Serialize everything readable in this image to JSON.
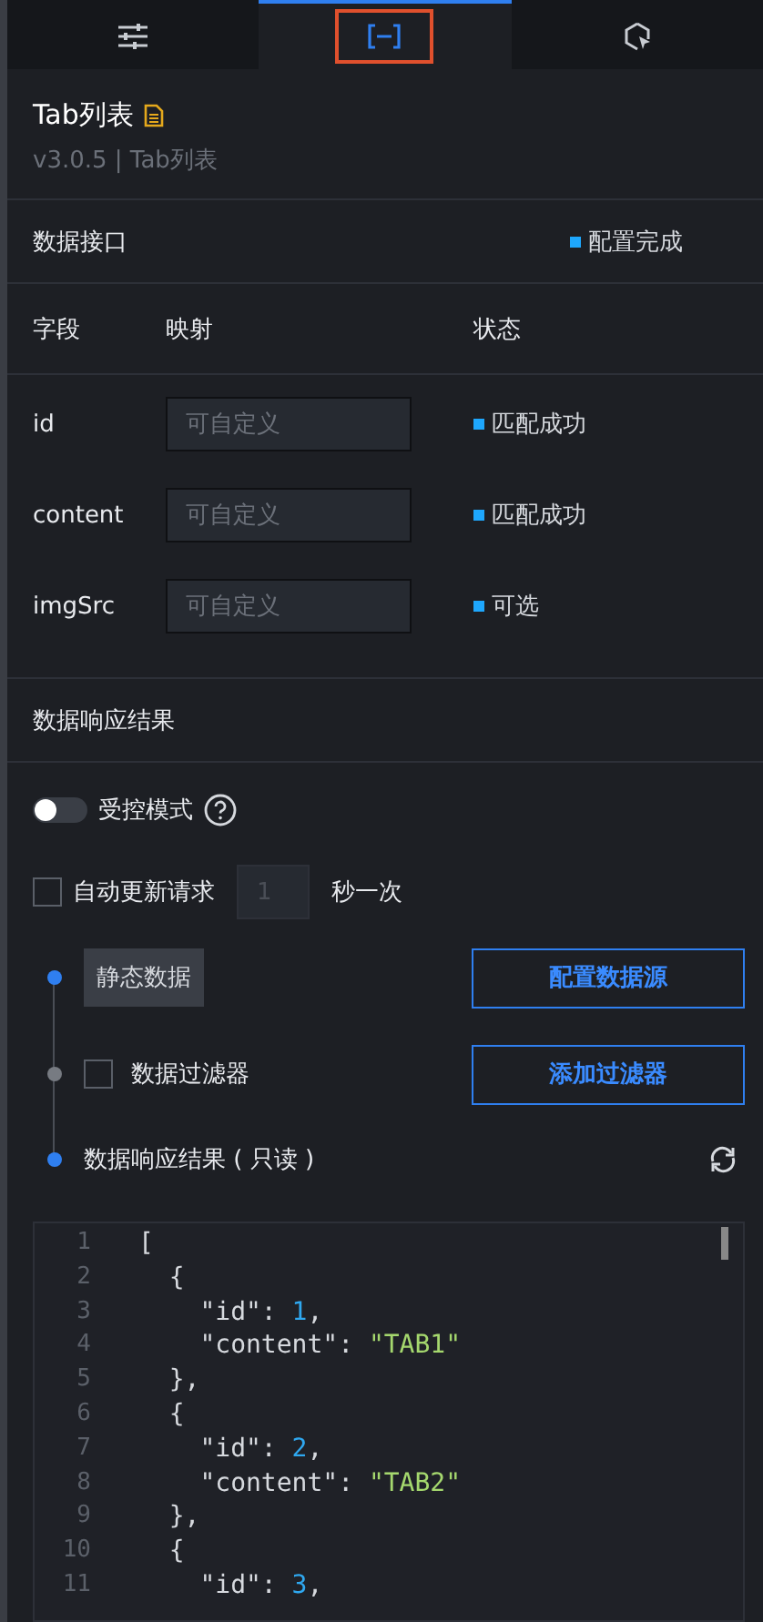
{
  "tabs": [
    {
      "kind": "sliders",
      "selected": false
    },
    {
      "kind": "bracket",
      "selected": true
    },
    {
      "kind": "cursor",
      "selected": false
    }
  ],
  "title": "Tab列表",
  "subtitle": "v3.0.5 | Tab列表",
  "interface": {
    "label": "数据接口",
    "status": "配置完成"
  },
  "fields": {
    "columns": [
      "字段",
      "映射",
      "状态"
    ],
    "rows": [
      {
        "name": "id",
        "placeholder": "可自定义",
        "status": "匹配成功"
      },
      {
        "name": "content",
        "placeholder": "可自定义",
        "status": "匹配成功"
      },
      {
        "name": "imgSrc",
        "placeholder": "可自定义",
        "status": "可选"
      }
    ]
  },
  "result_label": "数据响应结果",
  "controlled": {
    "label": "受控模式",
    "on": false
  },
  "auto_update": {
    "label": "自动更新请求",
    "checked": false,
    "value": "1",
    "unit": "秒一次"
  },
  "steps": [
    {
      "kind": "source",
      "active": true,
      "tag": "静态数据",
      "button": "配置数据源"
    },
    {
      "kind": "filter",
      "active": false,
      "label": "数据过滤器",
      "checked": false,
      "button": "添加过滤器"
    },
    {
      "kind": "result",
      "active": true,
      "label": "数据响应结果 ( 只读 )"
    }
  ],
  "editor": {
    "lines": [
      {
        "number": "1",
        "tokens": [
          {
            "kind": "punct",
            "text": "["
          }
        ]
      },
      {
        "number": "2",
        "tokens": [
          {
            "kind": "punct",
            "text": "  {"
          }
        ]
      },
      {
        "number": "3",
        "tokens": [
          {
            "kind": "key",
            "text": "    \"id\": "
          },
          {
            "kind": "number",
            "text": "1"
          },
          {
            "kind": "punct",
            "text": ","
          }
        ]
      },
      {
        "number": "4",
        "tokens": [
          {
            "kind": "key",
            "text": "    \"content\": "
          },
          {
            "kind": "string",
            "text": "\"TAB1\""
          }
        ]
      },
      {
        "number": "5",
        "tokens": [
          {
            "kind": "punct",
            "text": "  },"
          }
        ]
      },
      {
        "number": "6",
        "tokens": [
          {
            "kind": "punct",
            "text": "  {"
          }
        ]
      },
      {
        "number": "7",
        "tokens": [
          {
            "kind": "key",
            "text": "    \"id\": "
          },
          {
            "kind": "number",
            "text": "2"
          },
          {
            "kind": "punct",
            "text": ","
          }
        ]
      },
      {
        "number": "8",
        "tokens": [
          {
            "kind": "key",
            "text": "    \"content\": "
          },
          {
            "kind": "string",
            "text": "\"TAB2\""
          }
        ]
      },
      {
        "number": "9",
        "tokens": [
          {
            "kind": "punct",
            "text": "  },"
          }
        ]
      },
      {
        "number": "10",
        "tokens": [
          {
            "kind": "punct",
            "text": "  {"
          }
        ]
      },
      {
        "number": "11",
        "tokens": [
          {
            "kind": "key",
            "text": "    \"id\": "
          },
          {
            "kind": "number",
            "text": "3"
          },
          {
            "kind": "punct",
            "text": ","
          }
        ]
      }
    ]
  }
}
